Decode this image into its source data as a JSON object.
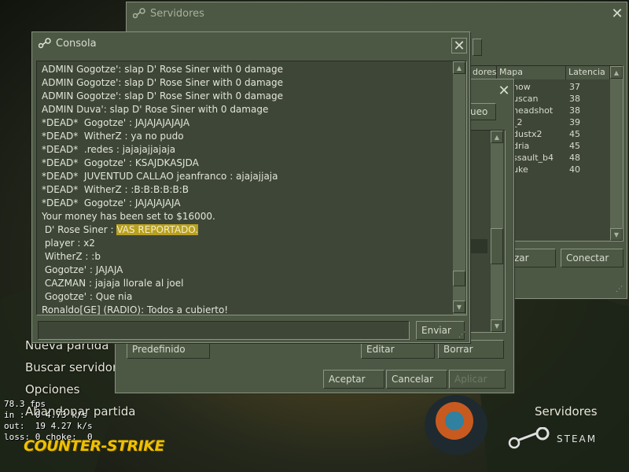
{
  "menu": {
    "items": [
      "Nueva partida",
      "Buscar servidores",
      "Opciones",
      "Abandonar partida"
    ]
  },
  "net_stats": {
    "fps": "78.3 fps",
    "in": "in :  0 4.73 k/s",
    "out": "out:  19 4.27 k/s",
    "loss": "loss: 0 choke:  0"
  },
  "branding": {
    "game_logo": "COUNTER-STRIKE",
    "servers_link": "Servidores",
    "steam_label": "STEAM"
  },
  "servers_window": {
    "title": "Servidores",
    "columns": [
      "dores",
      "Mapa",
      "Latencia"
    ],
    "rows": [
      {
        "map": "how",
        "latency": "37"
      },
      {
        "map": "uscan",
        "latency": "38"
      },
      {
        "map": "headshot",
        "latency": "38"
      },
      {
        "map": "_2",
        "latency": "39"
      },
      {
        "map": "dustx2",
        "latency": "45"
      },
      {
        "map": "dria",
        "latency": "45"
      },
      {
        "map": "ssault_b4",
        "latency": "48"
      },
      {
        "map": "uke",
        "latency": "40"
      }
    ],
    "btn_partial": "zar",
    "btn_connect": "Conectar"
  },
  "options_window": {
    "tab_partial": "ueo",
    "btn_predefinido": "Predefinido",
    "btn_editar": "Editar",
    "btn_borrar": "Borrar",
    "btn_aceptar": "Aceptar",
    "btn_cancelar": "Cancelar",
    "btn_aplicar": "Aplicar"
  },
  "console": {
    "title": "Consola",
    "send_label": "Enviar",
    "input_value": "",
    "lines": [
      {
        "text": "ADMIN Gogotze': slap D' Rose Siner with 0 damage"
      },
      {
        "text": "ADMIN Gogotze': slap D' Rose Siner with 0 damage"
      },
      {
        "text": "ADMIN Gogotze': slap D' Rose Siner with 0 damage"
      },
      {
        "text": "ADMIN Duva': slap D' Rose Siner with 0 damage"
      },
      {
        "text": "*DEAD*  Gogotze' : JAJAJAJAJAJA"
      },
      {
        "text": "*DEAD*  WitherZ : ya no pudo"
      },
      {
        "text": "*DEAD*  .redes : jajajajjajaja"
      },
      {
        "text": "*DEAD*  Gogotze' : KSAJDKASJDA"
      },
      {
        "text": "*DEAD*  JUVENTUD CALLAO jeanfranco : ajajajjaja"
      },
      {
        "text": "*DEAD*  WitherZ : :B:B:B:B:B:B"
      },
      {
        "text": "*DEAD*  Gogotze' : JAJAJAJAJA"
      },
      {
        "text": "Your money has been set to $16000."
      },
      {
        "text": " D' Rose Siner : ",
        "highlight": "VAS REPORTADO."
      },
      {
        "text": " player : x2"
      },
      {
        "text": " WitherZ : :b"
      },
      {
        "text": " Gogotze' : JAJAJA"
      },
      {
        "text": " CAZMAN : jajaja llorale al joel"
      },
      {
        "text": " Gogotze' : Que nia"
      },
      {
        "text": "Ronaldo[GE] (RADIO): Todos a cubierto!"
      }
    ]
  },
  "colors": {
    "panel": "#4c5844",
    "panel_inset": "#3e4637",
    "highlight": "#b8a020",
    "logo": "#f0c000"
  }
}
